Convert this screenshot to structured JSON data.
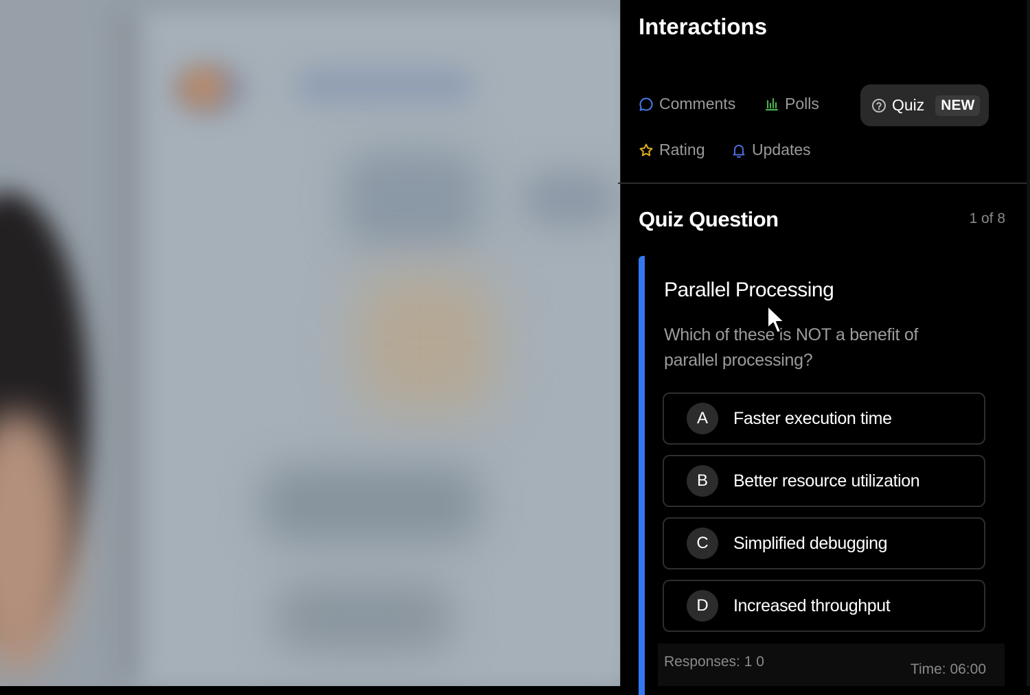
{
  "panel": {
    "title": "Interactions",
    "tabs": {
      "comments": "Comments",
      "polls": "Polls",
      "quiz": "Quiz",
      "quiz_badge": "NEW",
      "rating": "Rating",
      "updates": "Updates"
    },
    "active_tab": "Quiz"
  },
  "quiz": {
    "heading": "Quiz Question",
    "progress": "1 of 8",
    "topic": "Parallel Processing",
    "question": "Which of these is NOT a benefit of parallel processing?",
    "options": [
      {
        "letter": "A",
        "text": "Faster execution time"
      },
      {
        "letter": "B",
        "text": "Better resource utilization"
      },
      {
        "letter": "C",
        "text": "Simplified debugging"
      },
      {
        "letter": "D",
        "text": "Increased throughput"
      }
    ],
    "responses": "Responses: 1 0",
    "time": "Time: 06:00"
  },
  "colors": {
    "accent": "#3478f0",
    "panel_bg": "#000000",
    "comments_icon": "#4a7cf0",
    "polls_icon": "#4caf50",
    "rating_icon": "#e0b020",
    "updates_icon": "#4a6cd8"
  },
  "icons": {
    "comments": "chat-bubble-icon",
    "polls": "bar-chart-icon",
    "quiz": "question-circle-icon",
    "rating": "star-icon",
    "updates": "bell-icon"
  }
}
